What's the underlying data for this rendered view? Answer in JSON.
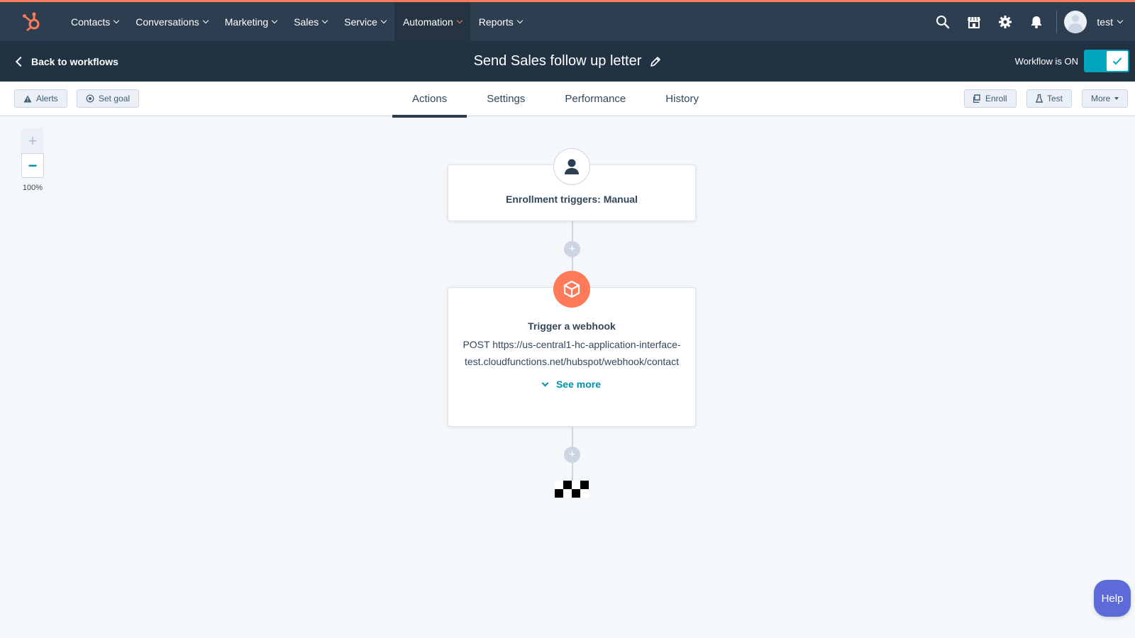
{
  "nav": {
    "items": [
      {
        "label": "Contacts"
      },
      {
        "label": "Conversations"
      },
      {
        "label": "Marketing"
      },
      {
        "label": "Sales"
      },
      {
        "label": "Service"
      },
      {
        "label": "Automation"
      },
      {
        "label": "Reports"
      }
    ],
    "active": "Automation",
    "icons": [
      "search-icon",
      "marketplace-icon",
      "settings-icon",
      "notifications-icon"
    ],
    "user": {
      "name": "test"
    }
  },
  "subheader": {
    "back_label": "Back to workflows",
    "title": "Send Sales follow up letter",
    "status_label": "Workflow is ON",
    "toggle_on": true
  },
  "toolbar": {
    "alerts_label": "Alerts",
    "set_goal_label": "Set goal",
    "tabs": [
      {
        "label": "Actions"
      },
      {
        "label": "Settings"
      },
      {
        "label": "Performance"
      },
      {
        "label": "History"
      }
    ],
    "active_tab": "Actions",
    "enroll_label": "Enroll",
    "test_label": "Test",
    "more_label": "More"
  },
  "zoom": {
    "level": "100%"
  },
  "workflow": {
    "trigger": {
      "title": "Enrollment triggers: Manual",
      "icon": "contact-icon"
    },
    "action": {
      "title": "Trigger a webhook",
      "description": "POST https://us-central1-hc-application-interface-test.cloudfunctions.net/hubspot/webhook/contact",
      "see_more_label": "See more",
      "icon": "box-icon"
    }
  },
  "help_label": "Help",
  "colors": {
    "accent": "#ff7a59",
    "nav_bg": "#2d3e50",
    "toggle": "#00a4bd",
    "link": "#0091ae",
    "help": "#5c6bd8"
  }
}
